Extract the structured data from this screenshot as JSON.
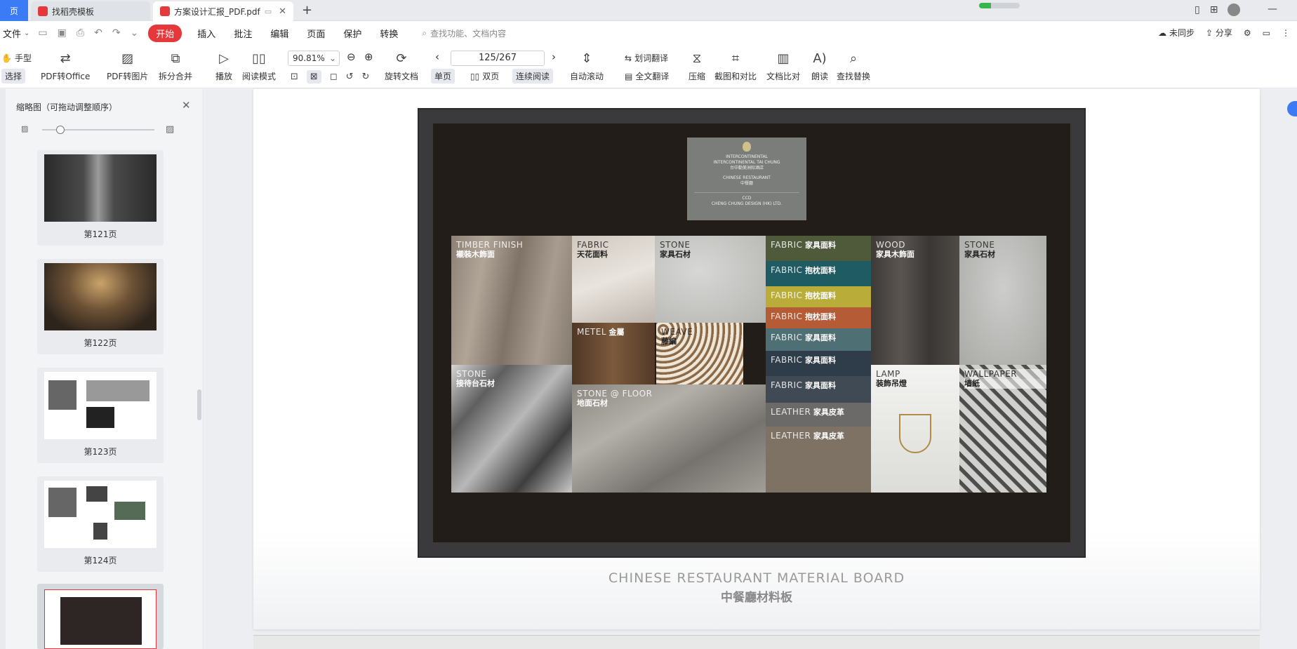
{
  "tabs": {
    "home": "页",
    "items": [
      {
        "label": "找稻壳模板"
      },
      {
        "label": "方案设计汇报_PDF.pdf"
      }
    ]
  },
  "menu": {
    "file": "文件",
    "start": "开始",
    "items": [
      "插入",
      "批注",
      "编辑",
      "页面",
      "保护",
      "转换"
    ],
    "search_placeholder": "查找功能、文档内容",
    "sync": "未同步",
    "share": "分享"
  },
  "toolbar": {
    "hand": "手型",
    "select": "选择",
    "pdf_to_office": "PDF转Office",
    "pdf_to_image": "PDF转图片",
    "split_merge": "拆分合并",
    "play": "播放",
    "read_mode": "阅读模式",
    "zoom": "90.81%",
    "page": "125/267",
    "rotate": "旋转文档",
    "single": "单页",
    "double": "双页",
    "continuous": "连续阅读",
    "auto_scroll": "自动滚动",
    "translate_word": "划词翻译",
    "translate_full": "全文翻译",
    "compress": "压缩",
    "screenshot_compare": "截图和对比",
    "doc_compare": "文档比对",
    "read_aloud": "朗读",
    "find_replace": "查找替换"
  },
  "sidebar": {
    "title": "缩略图（可拖动调整顺序）",
    "thumbs": [
      {
        "label": "第121页"
      },
      {
        "label": "第122页"
      },
      {
        "label": "第123页"
      },
      {
        "label": "第124页"
      }
    ]
  },
  "board": {
    "logo": {
      "line1": "INTERCONTINENTAL",
      "line2": "INTERCONTINENTAL TAI CHUNG",
      "line3": "台中勤美洲际酒店",
      "line4": "CHINESE RESTAURANT",
      "line5": "中餐廳",
      "line6": "CCD",
      "line7": "CHENG CHUNG DESIGN (HK) LTD."
    },
    "swatches": [
      {
        "en": "TIMBER FINISH",
        "zh": "襯裝木飾面"
      },
      {
        "en": "FABRIC",
        "zh": "天花面料"
      },
      {
        "en": "STONE",
        "zh": "家具石材"
      },
      {
        "en": "FABRIC",
        "zh": "家具面料"
      },
      {
        "en": "FABRIC",
        "zh": "抱枕面料"
      },
      {
        "en": "FABRIC",
        "zh": "抱枕面料"
      },
      {
        "en": "FABRIC",
        "zh": "抱枕面料"
      },
      {
        "en": "FABRIC",
        "zh": "家具面料"
      },
      {
        "en": "FABRIC",
        "zh": "家具面料"
      },
      {
        "en": "FABRIC",
        "zh": "家具面料"
      },
      {
        "en": "LEATHER",
        "zh": "家具皮革"
      },
      {
        "en": "LEATHER",
        "zh": "家具皮革"
      },
      {
        "en": "WOOD",
        "zh": "家具木飾面"
      },
      {
        "en": "STONE",
        "zh": "家具石材"
      },
      {
        "en": "METEL",
        "zh": "金屬"
      },
      {
        "en": "WEAVE",
        "zh": "藤編"
      },
      {
        "en": "STONE",
        "zh": "接待台石材"
      },
      {
        "en": "STONE @ FLOOR",
        "zh": "地面石材"
      },
      {
        "en": "LAMP",
        "zh": "装飾吊燈"
      },
      {
        "en": "WALLPAPER",
        "zh": "墙紙"
      }
    ],
    "caption_en": "CHINESE RESTAURANT MATERIAL BOARD",
    "caption_zh": "中餐廳材料板"
  }
}
